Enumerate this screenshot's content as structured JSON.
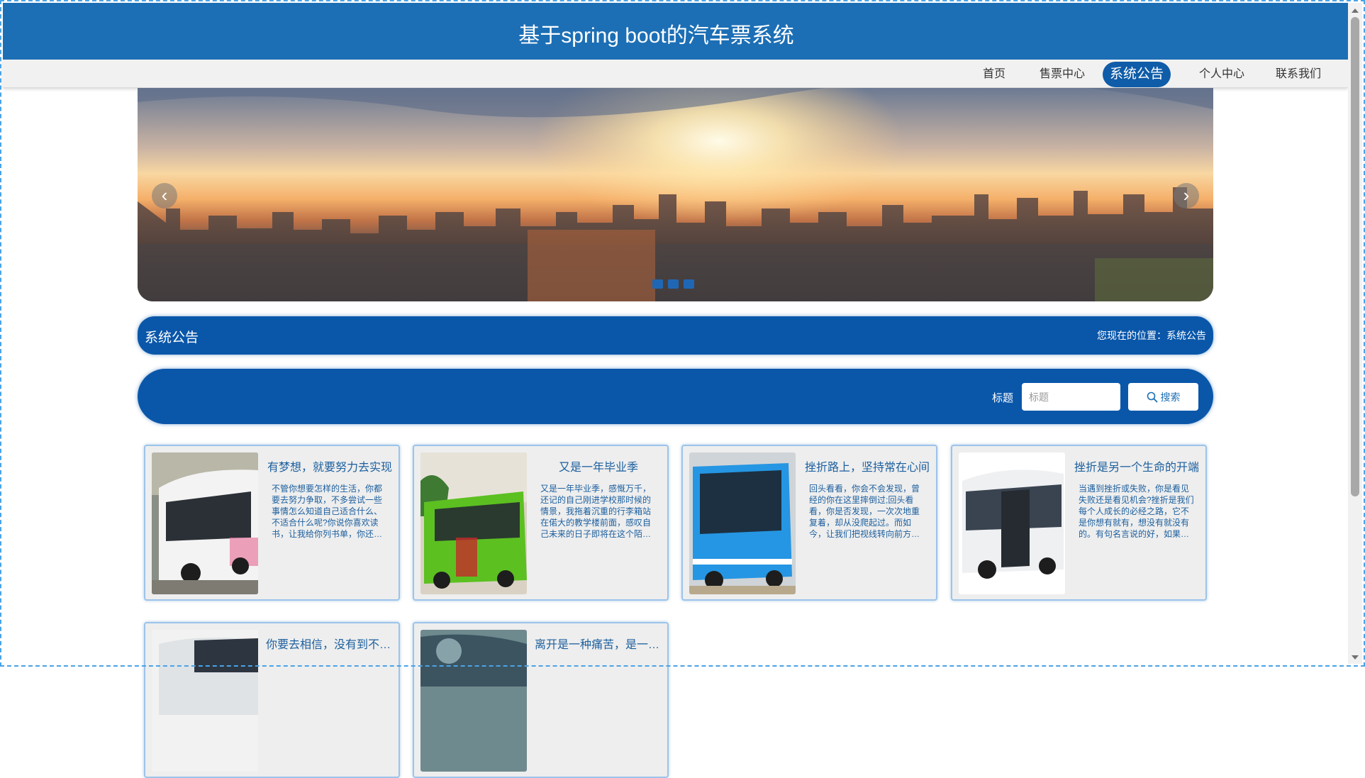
{
  "header": {
    "title": "基于spring boot的汽车票系统"
  },
  "nav": {
    "items": [
      {
        "label": "首页"
      },
      {
        "label": "售票中心"
      },
      {
        "label": "系统公告"
      },
      {
        "label": "个人中心"
      },
      {
        "label": "联系我们"
      }
    ],
    "active_index": 2
  },
  "banner": {
    "prev_icon": "chevron-left-icon",
    "next_icon": "chevron-right-icon",
    "slide_count": 3
  },
  "section": {
    "title": "系统公告",
    "breadcrumb": "您现在的位置：系统公告"
  },
  "search": {
    "label": "标题",
    "placeholder": "标题",
    "button_label": "搜索",
    "button_icon": "search-icon"
  },
  "notices": [
    {
      "title": "有梦想，就要努力去实现",
      "text": "不管你想要怎样的生活，你都要去努力争取，不多尝试一些事情怎么知道自己适合什么、不适合什么呢?你说你喜欢读书，让我给你列书单，你还…"
    },
    {
      "title": "又是一年毕业季",
      "text": "又是一年毕业季，感慨万千，还记的自己刚进学校那时候的情景，我拖着沉重的行李箱站在偌大的教学楼前面，感叹自己未来的日子即将在这个陌…"
    },
    {
      "title": "挫折路上，坚持常在心间",
      "text": "回头看看，你会不会发现，曾经的你在这里摔倒过;回头看看，你是否发现，一次次地重复着，却从没爬起过。而如今，让我们把视线转向前方…"
    },
    {
      "title": "挫折是另一个生命的开端",
      "text": "当遇到挫折或失败，你是看见失败还是看见机会?挫折是我们每个人成长的必经之路，它不是你想有就有，想没有就没有的。有句名言说的好，如果…"
    },
    {
      "title": "你要去相信，没有到不了的明天",
      "text": ""
    },
    {
      "title": "离开是一种痛苦，是一种勇气",
      "text": ""
    }
  ]
}
